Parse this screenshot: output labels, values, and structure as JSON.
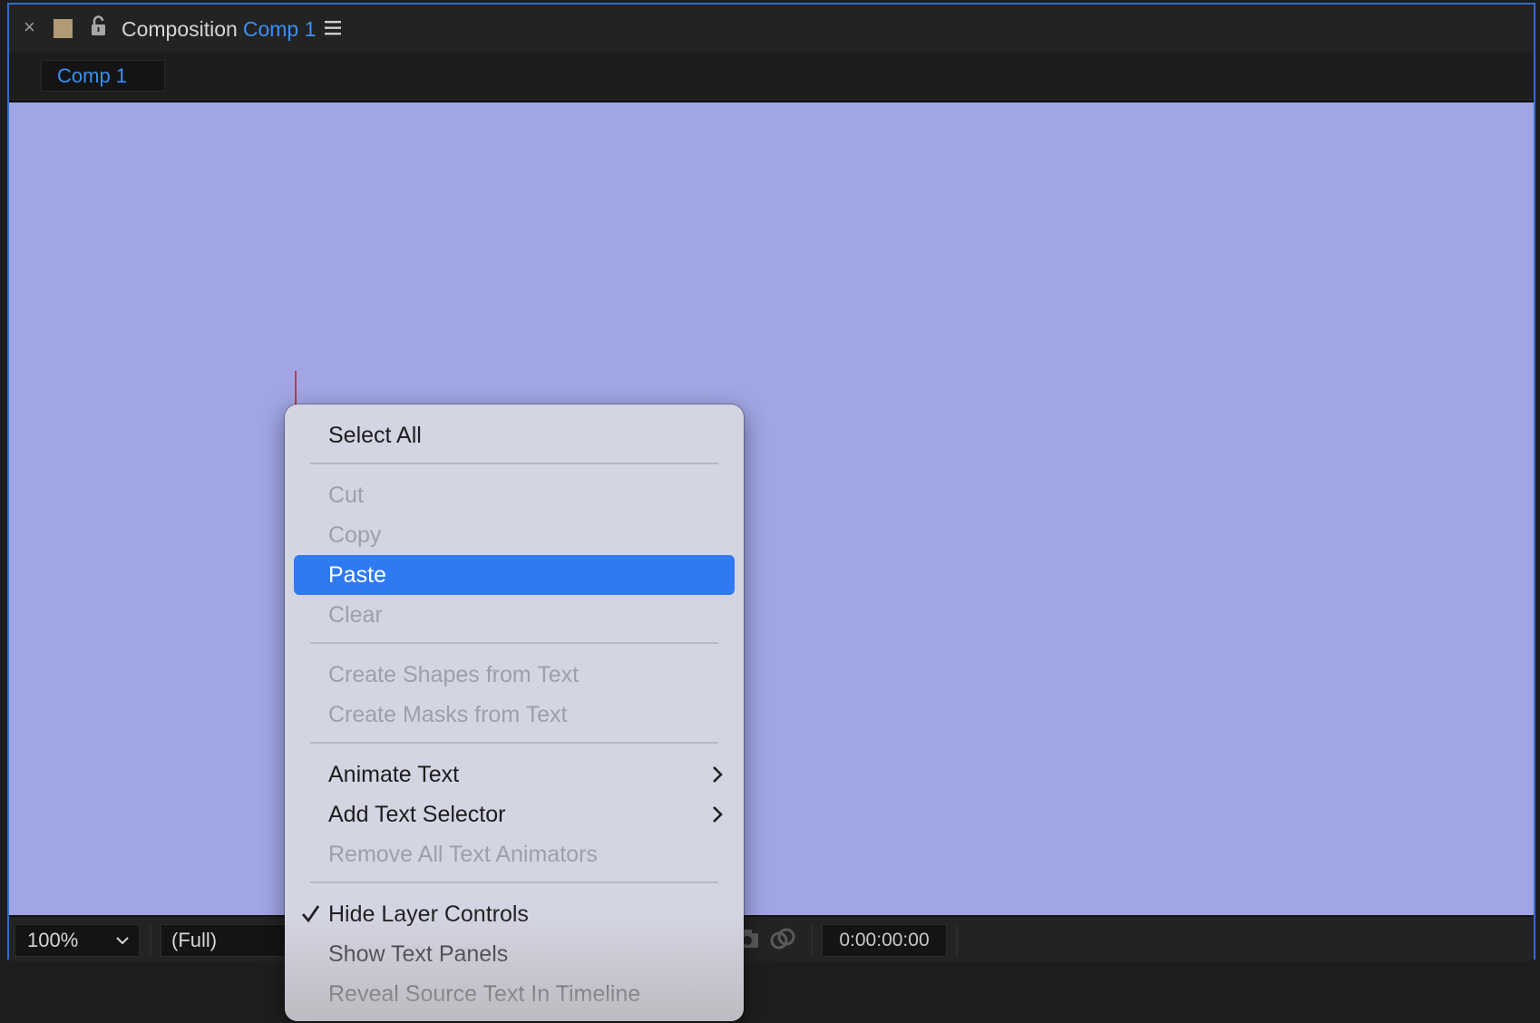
{
  "panel": {
    "title": "Composition",
    "comp_name": "Comp 1",
    "tab_label": "Comp 1",
    "accent_color": "#3b8ff5",
    "viewer_bg_color": "#a0a6e4",
    "icons": [
      "close-icon",
      "color-swatch-icon",
      "lock-icon",
      "panel-menu-icon"
    ]
  },
  "bottom_bar": {
    "zoom": "100%",
    "resolution": "(Full)",
    "timecode": "0:00:00:00",
    "icons": [
      "chevron-down-icon",
      "camera-icon",
      "show-channel-icon"
    ]
  },
  "context_menu": {
    "items": [
      {
        "label": "Select All",
        "enabled": true
      },
      {
        "label": "Cut",
        "enabled": false
      },
      {
        "label": "Copy",
        "enabled": false
      },
      {
        "label": "Paste",
        "enabled": true,
        "highlighted": true
      },
      {
        "label": "Clear",
        "enabled": false
      },
      {
        "label": "Create Shapes from Text",
        "enabled": false
      },
      {
        "label": "Create Masks from Text",
        "enabled": false
      },
      {
        "label": "Animate Text",
        "enabled": true,
        "submenu": true
      },
      {
        "label": "Add Text Selector",
        "enabled": true,
        "submenu": true
      },
      {
        "label": "Remove All Text Animators",
        "enabled": false
      },
      {
        "label": "Hide Layer Controls",
        "enabled": true,
        "checked": true
      },
      {
        "label": "Show Text Panels",
        "enabled": true
      },
      {
        "label": "Reveal Source Text In Timeline",
        "enabled": true
      }
    ],
    "highlight_color": "#2f7af2"
  }
}
